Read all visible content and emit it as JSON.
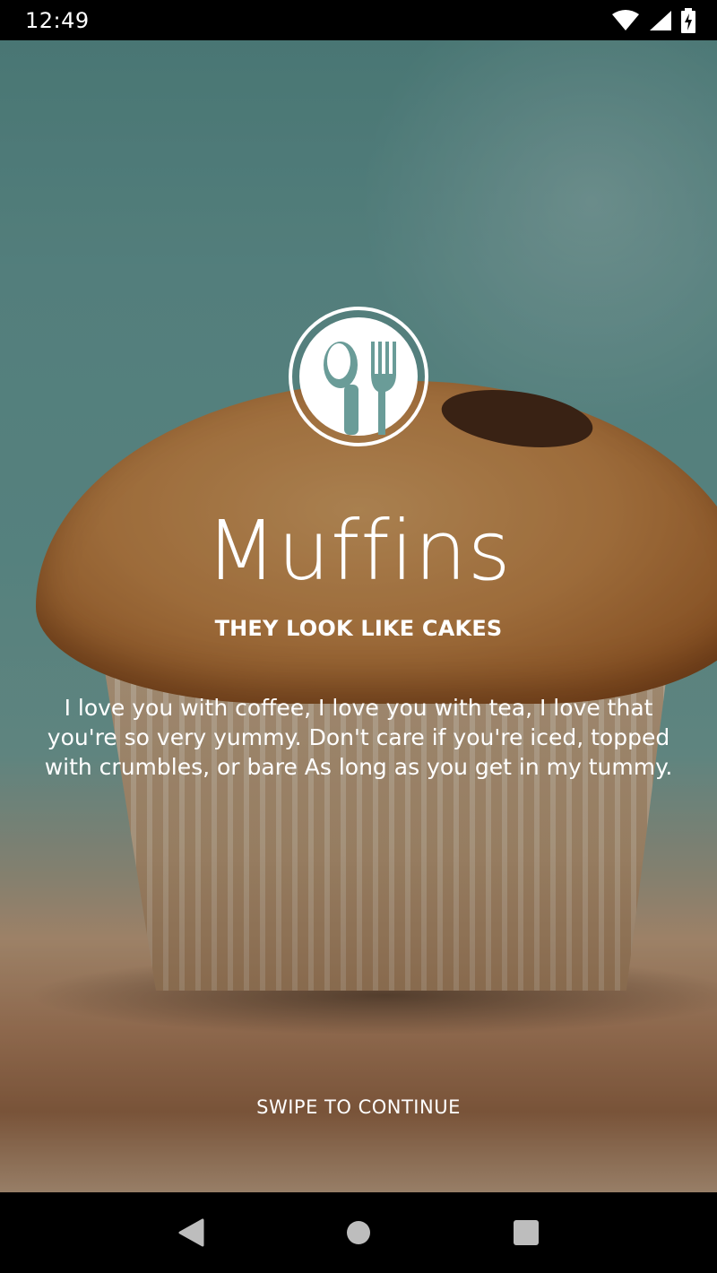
{
  "status_bar": {
    "time": "12:49",
    "icons": [
      "wifi-icon",
      "cellular-signal-icon",
      "battery-charging-icon"
    ]
  },
  "splash": {
    "logo_icon": "spoon-fork-icon",
    "title": "Muffins",
    "tagline": "THEY LOOK LIKE CAKES",
    "poem": "I love you with coffee, I love you with tea, I love that you're so very yummy. Don't care if you're iced, topped with crumbles, or bare As long as you get in my tummy.",
    "swipe_hint": "SWIPE TO CONTINUE"
  },
  "nav_bar": {
    "buttons": [
      "back-icon",
      "home-icon",
      "recents-icon"
    ]
  },
  "colors": {
    "text": "#ffffff",
    "bars": "#000000",
    "background_teal": "#6ba29f"
  }
}
